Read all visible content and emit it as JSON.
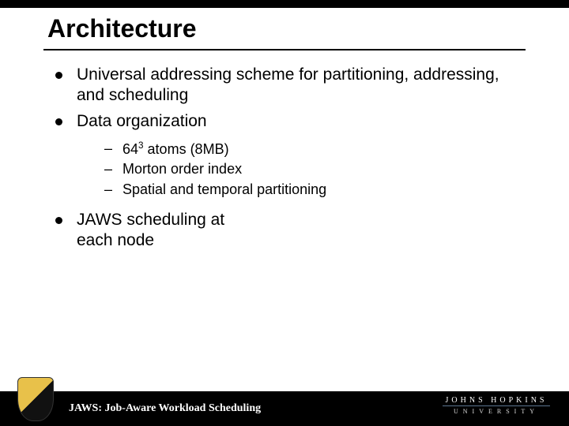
{
  "title": "Architecture",
  "bullets": {
    "b1": "Universal addressing scheme for partitioning, addressing, and scheduling",
    "b2": "Data organization",
    "b3": "JAWS scheduling at each node"
  },
  "sub": {
    "s1_prefix": "64",
    "s1_sup": "3",
    "s1_suffix": " atoms (8MB)",
    "s2": "Morton order index",
    "s3": "Spatial and temporal partitioning"
  },
  "footer": "JAWS: Job-Aware Workload Scheduling",
  "logo": {
    "line1": "JOHNS HOPKINS",
    "line2": "UNIVERSITY"
  }
}
